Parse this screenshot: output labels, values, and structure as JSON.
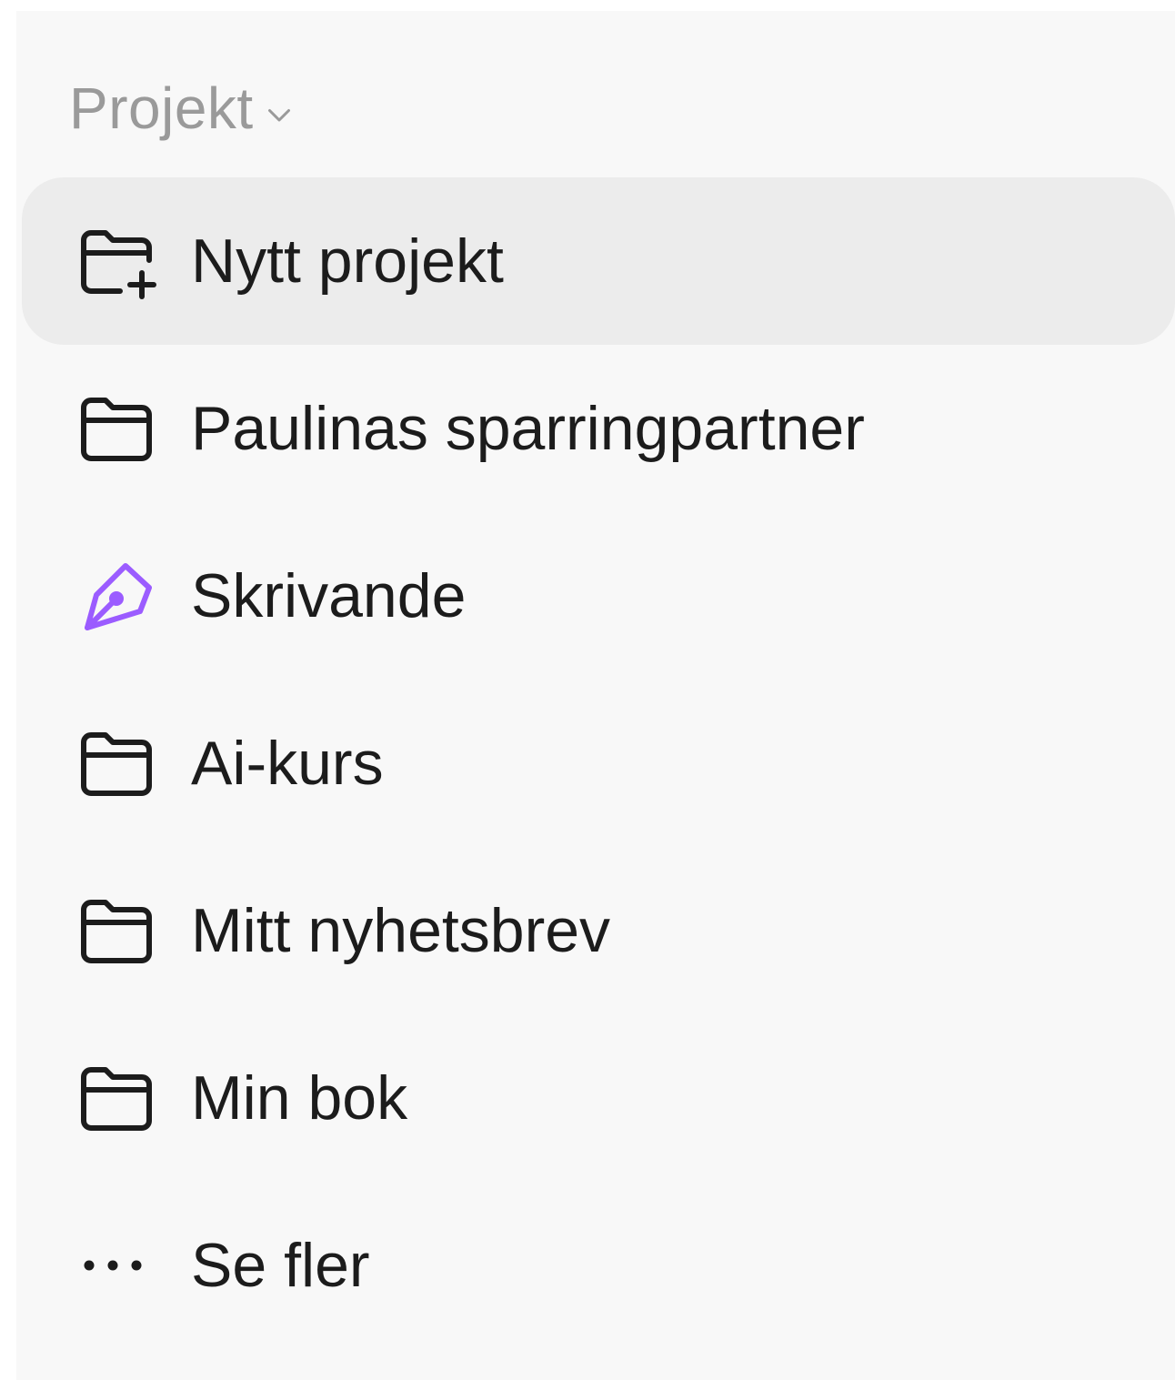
{
  "section": {
    "title": "Projekt",
    "toggle_icon": "chevron-down-icon"
  },
  "items": [
    {
      "label": "Nytt projekt",
      "icon": "folder-plus-icon",
      "active": true
    },
    {
      "label": "Paulinas sparringpartner",
      "icon": "folder-icon",
      "active": false
    },
    {
      "label": "Skrivande",
      "icon": "pen-nib-icon",
      "active": false,
      "icon_color": "#9b5cff"
    },
    {
      "label": "Ai-kurs",
      "icon": "folder-icon",
      "active": false
    },
    {
      "label": "Mitt nyhetsbrev",
      "icon": "folder-icon",
      "active": false
    },
    {
      "label": "Min bok",
      "icon": "folder-icon",
      "active": false
    },
    {
      "label": "Se fler",
      "icon": "more-dots-icon",
      "active": false
    }
  ],
  "colors": {
    "panel_bg": "#f8f8f8",
    "active_bg": "#ececec",
    "header_text": "#9a9a9a",
    "item_text": "#1c1c1c",
    "accent_purple": "#9b5cff"
  }
}
